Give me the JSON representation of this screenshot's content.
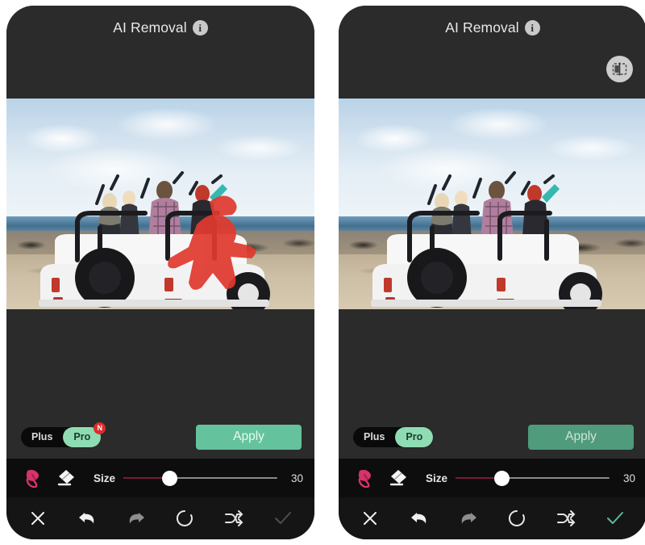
{
  "app": {
    "title": "AI Removal",
    "info_icon": "info-icon",
    "accent_green": "#64c39c",
    "accent_pro": "#8fdcb3",
    "badge_red": "#e02b2b",
    "brush_pink": "#d6336c",
    "slider_fill": "#7a1c33"
  },
  "panels": [
    {
      "id": "before",
      "header": {
        "title": "AI Removal",
        "has_compare_button": false,
        "compare_icon": "compare-before-after-icon"
      },
      "canvas": {
        "description": "People standing in white open-top jeep at beach",
        "mask_visible": true,
        "mask_color": "#e03a2f"
      },
      "plan": {
        "options": [
          "Plus",
          "Pro"
        ],
        "selected": "Pro",
        "badge": "N",
        "badge_visible": true
      },
      "apply": {
        "label": "Apply",
        "enabled": true
      },
      "tools": {
        "brush_icon": "brush-icon",
        "eraser_icon": "eraser-icon",
        "active_tool": "brush"
      },
      "slider": {
        "label": "Size",
        "value": "30",
        "percent": 30
      },
      "nav": [
        {
          "name": "close-button",
          "icon": "close-icon",
          "state": "normal"
        },
        {
          "name": "undo-button",
          "icon": "undo-arrow-icon",
          "state": "normal"
        },
        {
          "name": "redo-button",
          "icon": "redo-arrow-icon",
          "state": "disabled"
        },
        {
          "name": "reset-button",
          "icon": "reset-circle-icon",
          "state": "normal"
        },
        {
          "name": "compare-button",
          "icon": "shuffle-icon",
          "state": "normal"
        },
        {
          "name": "confirm-button",
          "icon": "check-icon",
          "state": "disabled"
        }
      ]
    },
    {
      "id": "after",
      "header": {
        "title": "AI Removal",
        "has_compare_button": true,
        "compare_icon": "compare-before-after-icon"
      },
      "canvas": {
        "description": "Same beach jeep scene with the selected person removed",
        "mask_visible": false,
        "mask_color": "#e03a2f"
      },
      "plan": {
        "options": [
          "Plus",
          "Pro"
        ],
        "selected": "Pro",
        "badge": "N",
        "badge_visible": false
      },
      "apply": {
        "label": "Apply",
        "enabled": false
      },
      "tools": {
        "brush_icon": "brush-icon",
        "eraser_icon": "eraser-icon",
        "active_tool": "brush"
      },
      "slider": {
        "label": "Size",
        "value": "30",
        "percent": 30
      },
      "nav": [
        {
          "name": "close-button",
          "icon": "close-icon",
          "state": "normal"
        },
        {
          "name": "undo-button",
          "icon": "undo-arrow-icon",
          "state": "normal"
        },
        {
          "name": "redo-button",
          "icon": "redo-arrow-icon",
          "state": "disabled"
        },
        {
          "name": "reset-button",
          "icon": "reset-circle-icon",
          "state": "normal"
        },
        {
          "name": "compare-button",
          "icon": "shuffle-icon",
          "state": "normal"
        },
        {
          "name": "confirm-button",
          "icon": "check-icon",
          "state": "active"
        }
      ]
    }
  ]
}
